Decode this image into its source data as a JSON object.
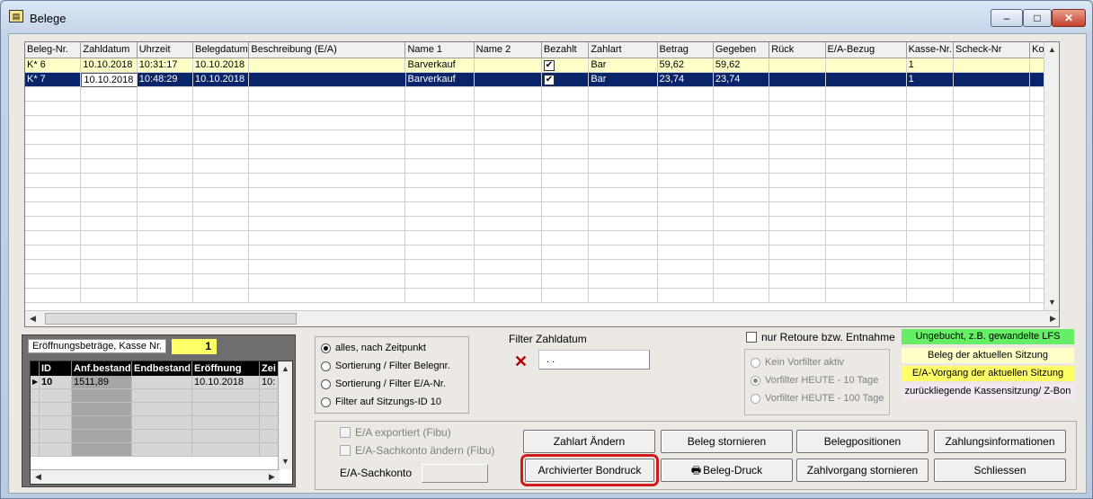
{
  "window": {
    "title": "Belege",
    "icon": "document-icon",
    "controls": {
      "minimize": "–",
      "maximize": "□",
      "close": "✕"
    }
  },
  "grid": {
    "columns": [
      "Beleg-Nr.",
      "Zahldatum",
      "Uhrzeit",
      "Belegdatum",
      "Beschreibung (E/A)",
      "Name 1",
      "Name 2",
      "Bezahlt",
      "Zahlart",
      "Betrag",
      "Gegeben",
      "Rück",
      "E/A-Bezug",
      "Kasse-Nr.",
      "Scheck-Nr",
      "Kor"
    ],
    "rows": [
      {
        "beleg": "K*  6",
        "zahldatum": "10.10.2018",
        "uhrzeit": "10:31:17",
        "belegdatum": "10.10.2018",
        "beschreibung": "",
        "name1": "Barverkauf",
        "name2": "",
        "bezahlt": "✔",
        "zahlart": "Bar",
        "betrag": "59,62",
        "gegeben": "59,62",
        "rueck": "",
        "eabezug": "",
        "kasse": "1",
        "scheck": "",
        "kor": ""
      },
      {
        "beleg": "K*  7",
        "zahldatum": "10.10.2018",
        "uhrzeit": "10:48:29",
        "belegdatum": "10.10.2018",
        "beschreibung": "",
        "name1": "Barverkauf",
        "name2": "",
        "bezahlt": "✔",
        "zahlart": "Bar",
        "betrag": "23,74",
        "gegeben": "23,74",
        "rueck": "",
        "eabezug": "",
        "kasse": "1",
        "scheck": "",
        "kor": ""
      }
    ]
  },
  "opening": {
    "label": "Eröffnungsbeträge, Kasse Nr.",
    "kasse_nr": "1",
    "columns": [
      "ID",
      "Anf.bestand",
      "Endbestand",
      "Eröffnung",
      "Zei"
    ],
    "row": {
      "id": "10",
      "anf": "1511,89",
      "end": "",
      "eroeffnung": "10.10.2018",
      "zeit": "10:"
    }
  },
  "sort_options": [
    {
      "label": "alles, nach Zeitpunkt",
      "selected": true
    },
    {
      "label": "Sortierung / Filter Belegnr.",
      "selected": false
    },
    {
      "label": "Sortierung / Filter E/A-Nr.",
      "selected": false
    },
    {
      "label": "Filter auf Sitzungs-ID 10",
      "selected": false
    }
  ],
  "filter": {
    "title": "Filter Zahldatum",
    "clear": "✕",
    "value": " .  ."
  },
  "retoure": {
    "label": "nur Retoure bzw. Entnahme"
  },
  "vorfilter": [
    {
      "label": "Kein Vorfilter aktiv",
      "selected": false
    },
    {
      "label": "Vorfilter HEUTE - 10 Tage",
      "selected": true
    },
    {
      "label": "Vorfilter HEUTE - 100 Tage",
      "selected": false
    }
  ],
  "legend": {
    "ungebucht": "Ungebucht, z.B. gewandelte LFS",
    "aktuell": "Beleg der aktuellen Sitzung",
    "ea_vorgang": "E/A-Vorgang der aktuellen Sitzung",
    "zurueck": "zurückliegende Kassensitzung/ Z-Bon"
  },
  "options": {
    "exportiert": "E/A exportiert (Fibu)",
    "sachkonto_aendern": "E/A-Sachkonto ändern (Fibu)",
    "sachkonto_label": "E/A-Sachkonto"
  },
  "buttons": {
    "zahlart": "Zahlart Ändern",
    "storno": "Beleg stornieren",
    "positionen": "Belegpositionen",
    "zahlungsinfo": "Zahlungsinformationen",
    "archiv": "Archivierter Bondruck",
    "druck": "Beleg-Druck",
    "zahlstorno": "Zahlvorgang stornieren",
    "schliessen": "Schliessen"
  },
  "colors": {
    "selection": "#0a246a",
    "row_yellow": "#ffffc8",
    "legend_green": "#66ee66",
    "legend_yellow": "#ffff66",
    "highlight": "#d11a1a"
  }
}
